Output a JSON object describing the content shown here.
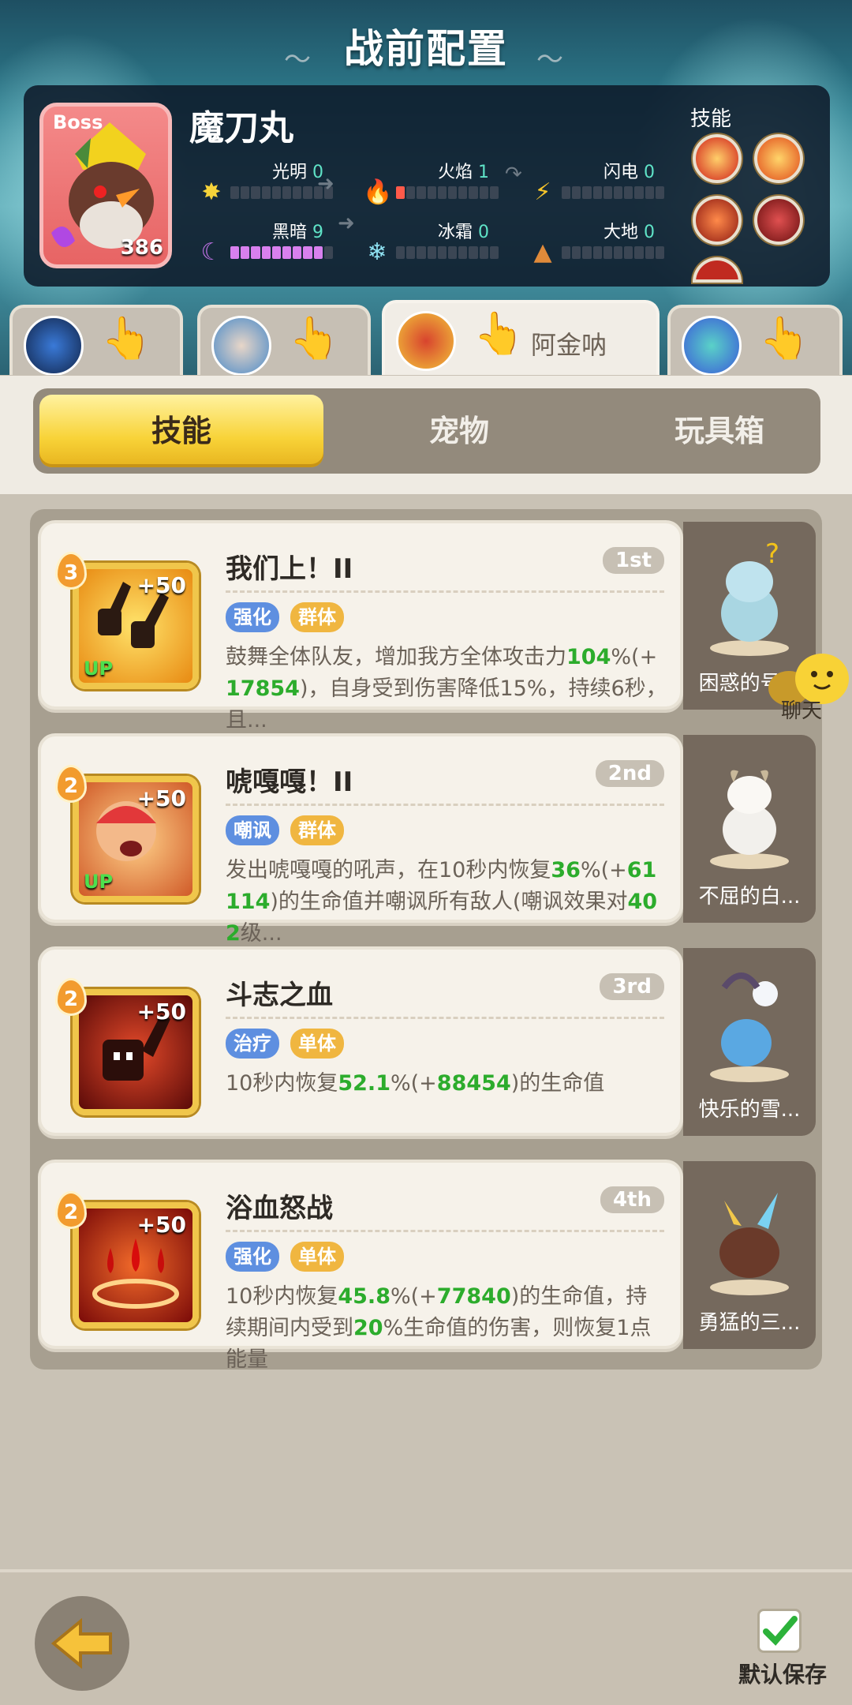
{
  "header": {
    "title": "战前配置"
  },
  "boss": {
    "tag": "Boss",
    "name": "魔刀丸",
    "level": "386",
    "skills_title": "技能",
    "elements": [
      {
        "name": "光明",
        "value": "0"
      },
      {
        "name": "火焰",
        "value": "1"
      },
      {
        "name": "闪电",
        "value": "0"
      },
      {
        "name": "黑暗",
        "value": "9"
      },
      {
        "name": "冰霜",
        "value": "0"
      },
      {
        "name": "大地",
        "value": "0"
      }
    ]
  },
  "hero_tabs": [
    {
      "name": ""
    },
    {
      "name": ""
    },
    {
      "name": "阿金呐"
    },
    {
      "name": ""
    }
  ],
  "sub_tabs": [
    "技能",
    "宠物",
    "玩具箱"
  ],
  "skills": [
    {
      "level": "3",
      "plus": "+50",
      "up": "UP",
      "name": "我们上！II",
      "rank": "1st",
      "tags": [
        "强化",
        "群体"
      ],
      "desc_parts": [
        {
          "t": "鼓舞全体队友，增加我方全体攻击力"
        },
        {
          "t": "104",
          "g": true
        },
        {
          "t": "%(+"
        },
        {
          "t": "17854",
          "g": true
        },
        {
          "t": ")，自身受到伤害降低15%，持续6秒，且..."
        }
      ],
      "pet": "困惑的号..."
    },
    {
      "level": "2",
      "plus": "+50",
      "up": "UP",
      "name": "唬嘎嘎！II",
      "rank": "2nd",
      "tags": [
        "嘲讽",
        "群体"
      ],
      "desc_parts": [
        {
          "t": "发出唬嘎嘎的吼声，在10秒内恢复"
        },
        {
          "t": "36",
          "g": true
        },
        {
          "t": "%(+"
        },
        {
          "t": "61114",
          "g": true
        },
        {
          "t": ")的生命值并嘲讽所有敌人(嘲讽效果对"
        },
        {
          "t": "402",
          "g": true
        },
        {
          "t": "级..."
        }
      ],
      "pet": "不屈的白..."
    },
    {
      "level": "2",
      "plus": "+50",
      "up": "",
      "name": "斗志之血",
      "rank": "3rd",
      "tags": [
        "治疗",
        "单体"
      ],
      "desc_parts": [
        {
          "t": "10秒内恢复"
        },
        {
          "t": "52.1",
          "g": true
        },
        {
          "t": "%(+"
        },
        {
          "t": "88454",
          "g": true
        },
        {
          "t": ")的生命值"
        }
      ],
      "pet": "快乐的雪..."
    },
    {
      "level": "2",
      "plus": "+50",
      "up": "",
      "name": "浴血怒战",
      "rank": "4th",
      "tags": [
        "强化",
        "单体"
      ],
      "desc_parts": [
        {
          "t": "10秒内恢复"
        },
        {
          "t": "45.8",
          "g": true
        },
        {
          "t": "%(+"
        },
        {
          "t": "77840",
          "g": true
        },
        {
          "t": ")的生命值，持续期间内受到"
        },
        {
          "t": "20",
          "g": true
        },
        {
          "t": "%生命值的伤害，则恢复1点能量"
        }
      ],
      "pet": "勇猛的三..."
    }
  ],
  "chat": {
    "label": "聊天"
  },
  "footer": {
    "save_label": "默认保存"
  },
  "colors": {
    "accent_gold": "#f8d338",
    "highlight_green": "#2cac2c",
    "tag_blue": "#5e8fe0",
    "tag_gold": "#f0b640"
  }
}
